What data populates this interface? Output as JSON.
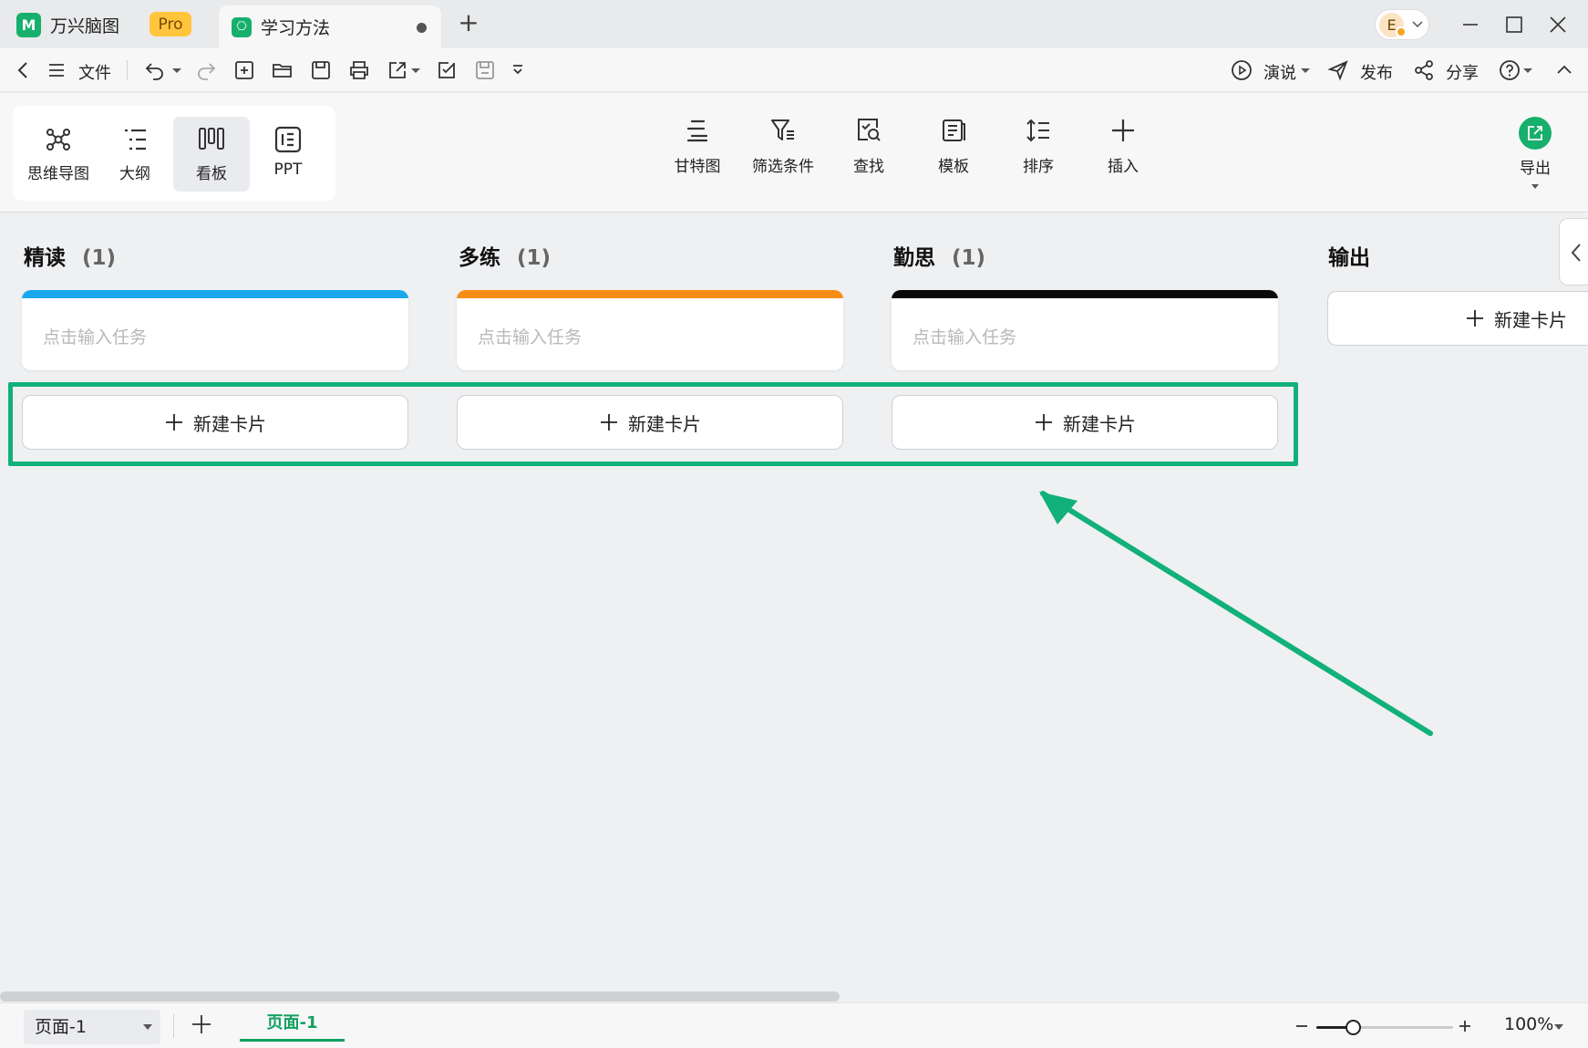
{
  "titlebar": {
    "app_name": "万兴脑图",
    "pro_label": "Pro",
    "doc_tab": "学习方法",
    "avatar_letter": "E"
  },
  "quickbar": {
    "file_label": "文件",
    "present_label": "演说",
    "publish_label": "发布",
    "share_label": "分享"
  },
  "view_switch": {
    "items": [
      {
        "label": "思维导图",
        "icon": "mindmap-icon"
      },
      {
        "label": "大纲",
        "icon": "outline-icon"
      },
      {
        "label": "看板",
        "icon": "kanban-icon",
        "active": true
      },
      {
        "label": "PPT",
        "icon": "ppt-icon"
      }
    ]
  },
  "ribbon_tools": [
    {
      "label": "甘特图",
      "icon": "gantt-icon"
    },
    {
      "label": "筛选条件",
      "icon": "filter-icon"
    },
    {
      "label": "查找",
      "icon": "find-icon"
    },
    {
      "label": "模板",
      "icon": "template-icon"
    },
    {
      "label": "排序",
      "icon": "sort-icon"
    },
    {
      "label": "插入",
      "icon": "insert-icon"
    }
  ],
  "export": {
    "label": "导出"
  },
  "board": {
    "columns": [
      {
        "title": "精读",
        "count": "(1)",
        "bar_color": "#1aa7ec",
        "placeholder": "点击输入任务",
        "new_card": "新建卡片"
      },
      {
        "title": "多练",
        "count": "(1)",
        "bar_color": "#f78c16",
        "placeholder": "点击输入任务",
        "new_card": "新建卡片"
      },
      {
        "title": "勤思",
        "count": "(1)",
        "bar_color": "#0a0a0a",
        "placeholder": "点击输入任务",
        "new_card": "新建卡片"
      },
      {
        "title": "输出",
        "new_card": "新建卡片"
      }
    ],
    "highlight_color": "#12b07a"
  },
  "statusbar": {
    "page_select": "页面-1",
    "page_tab": "页面-1",
    "zoom": "100%"
  },
  "colors": {
    "accent": "#16b06c",
    "pro": "#ffc53d"
  }
}
